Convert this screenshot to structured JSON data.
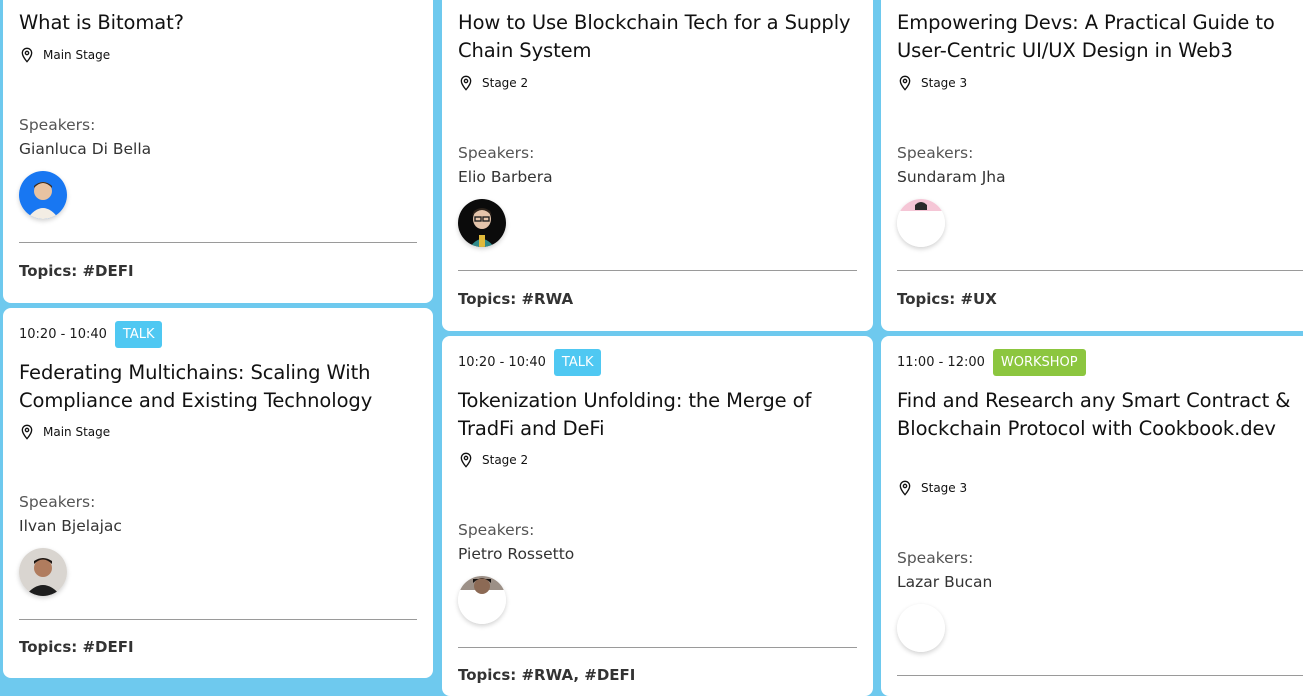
{
  "columns": [
    {
      "cards": [
        {
          "time": "",
          "type": "",
          "title": "What is Bitomat?",
          "stage": "Main Stage",
          "speakers_label": "Speakers:",
          "speaker": "Gianluca Di Bella",
          "topics": "Topics: #DEFI"
        },
        {
          "time": "10:20 - 10:40",
          "type": "TALK",
          "title": "Federating Multichains: Scaling With Compliance and Existing Technology",
          "stage": "Main Stage",
          "speakers_label": "Speakers:",
          "speaker": "Ilvan Bjelajac",
          "topics": "Topics: #DEFI"
        }
      ]
    },
    {
      "cards": [
        {
          "time": "",
          "type": "",
          "title": "How to Use Blockchain Tech for a Supply Chain System",
          "stage": "Stage 2",
          "speakers_label": "Speakers:",
          "speaker": "Elio Barbera",
          "topics": "Topics: #RWA"
        },
        {
          "time": "10:20 - 10:40",
          "type": "TALK",
          "title": "Tokenization Unfolding: the Merge of TradFi and DeFi",
          "stage": "Stage 2",
          "speakers_label": "Speakers:",
          "speaker": "Pietro Rossetto",
          "topics": "Topics: #RWA, #DEFI"
        }
      ]
    },
    {
      "cards": [
        {
          "time": "",
          "type": "",
          "title": "Empowering Devs: A Practical Guide to User-Centric UI/UX Design in Web3",
          "stage": "Stage 3",
          "speakers_label": "Speakers:",
          "speaker": "Sundaram Jha",
          "topics": "Topics: #UX"
        },
        {
          "time": "11:00 - 12:00",
          "type": "WORKSHOP",
          "title": "Find and Research any Smart Contract & Blockchain Protocol with Cookbook.dev",
          "stage": "Stage 3",
          "speakers_label": "Speakers:",
          "speaker": "Lazar Bucan",
          "topics": ""
        }
      ]
    }
  ],
  "colors": {
    "background": "#6ec9ee",
    "talk_badge": "#4fc8f2",
    "workshop_badge": "#8cc63f"
  },
  "icons": {
    "location": "map-pin-icon"
  }
}
